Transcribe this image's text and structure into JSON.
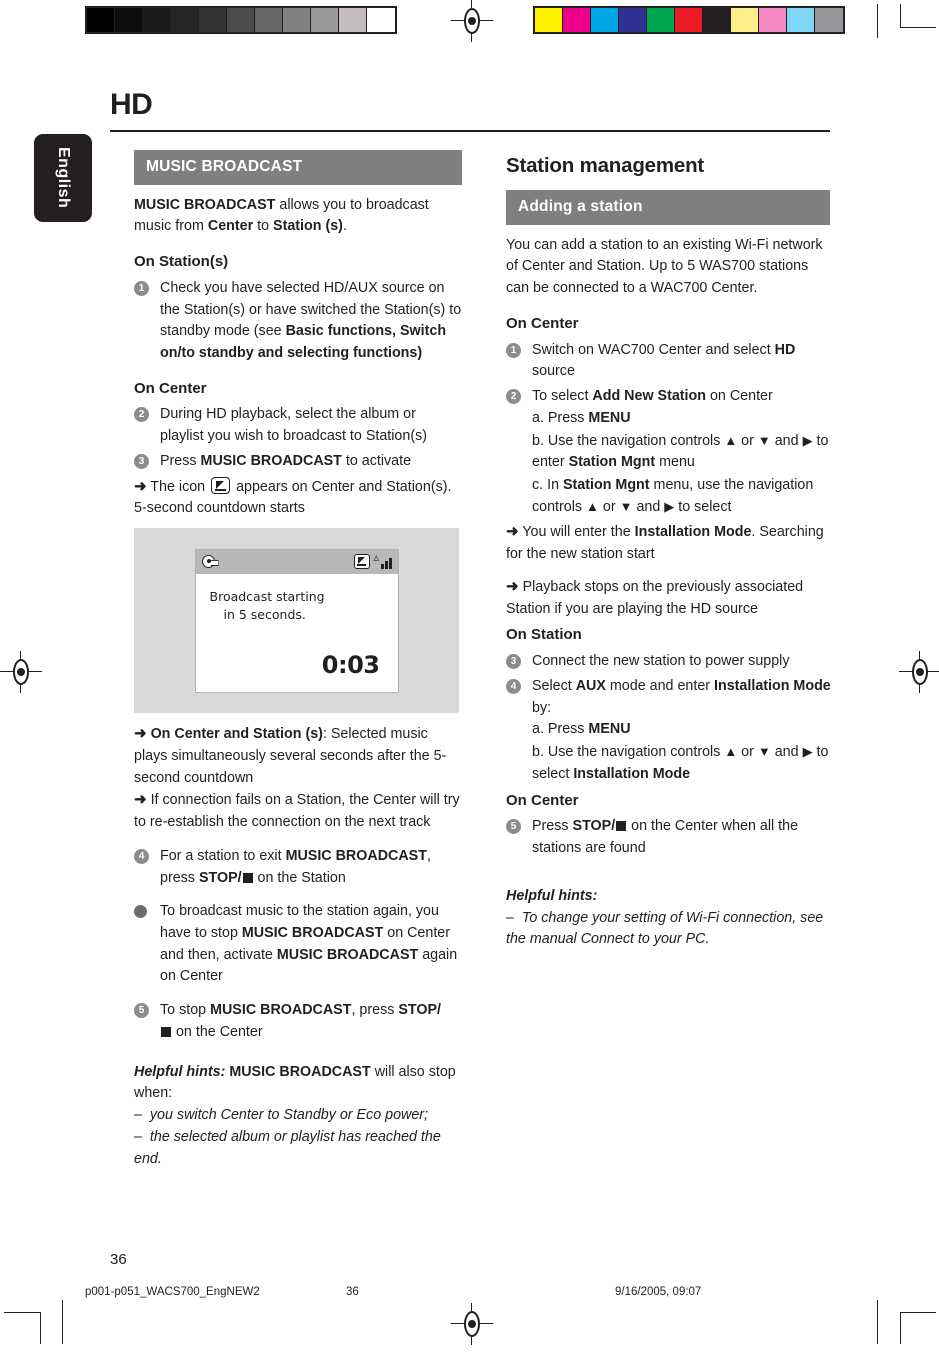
{
  "print_marks": {
    "gray_swatches": [
      "#000000",
      "#0d0d0d",
      "#1a1a1a",
      "#262626",
      "#333333",
      "#4d4d4d",
      "#666666",
      "#808080",
      "#999999",
      "#c4bcbc",
      "#ffffff"
    ],
    "color_swatches": [
      "#fff200",
      "#ec008c",
      "#00a7e7",
      "#2e3192",
      "#00a650",
      "#ed1c24",
      "#231f20",
      "#fdee87",
      "#f488c2",
      "#7fd6f7",
      "#939598"
    ]
  },
  "sidebar": {
    "language_tab": "English"
  },
  "header": {
    "chapter_title": "HD"
  },
  "left_column": {
    "section_bar": "MUSIC BROADCAST",
    "intro": {
      "lead": "MUSIC BROADCAST",
      "mid": " allows you to broadcast music from ",
      "center": "Center",
      "to": " to ",
      "station": "Station (s)",
      "period": "."
    },
    "subhead_station": "On Station(s)",
    "step1": {
      "num": "1",
      "text_a": "Check you have selected HD/AUX source on the Station(s) or have switched the Station(s) to standby mode (see ",
      "bold_b": "Basic functions, Switch on/to standby and selecting functions)"
    },
    "subhead_center": "On Center",
    "step2": {
      "num": "2",
      "text": "During HD playback,  select the album or playlist you wish to broadcast to Station(s)"
    },
    "step3": {
      "num": "3",
      "press": "Press ",
      "bold": "MUSIC BROADCAST",
      "tail": " to activate",
      "arrow_a": "The icon ",
      "arrow_b": " appears on Center and Station(s). 5-second countdown starts"
    },
    "lcd": {
      "message_line1": "Broadcast starting",
      "message_line2": "in 5 seconds.",
      "countdown": "0:03",
      "icons": {
        "left": "music-note-icon",
        "right_1": "broadcast-icon",
        "right_2": "signal-strength-icon"
      }
    },
    "result1": {
      "bold": "On Center and Station (s)",
      "text": ": Selected music plays simultaneously several seconds after the 5-second countdown"
    },
    "result2": {
      "text": "If connection fails on a Station, the Center will try to re-establish the connection on the next track"
    },
    "step4": {
      "num": "4",
      "pre": "For a station to exit ",
      "bold": "MUSIC BROADCAST",
      "mid": ", press ",
      "bold2": "STOP/",
      "post": " on the Station"
    },
    "bullet": {
      "pre": "To broadcast music to the station again, you have to stop ",
      "bold1": "MUSIC BROADCAST",
      "mid": " on Center and then, activate ",
      "bold2": "MUSIC BROADCAST",
      "post": " again on Center"
    },
    "step5": {
      "num": "5",
      "pre": "To stop ",
      "bold1": "MUSIC BROADCAST",
      "mid": ", press ",
      "bold2": "STOP/",
      "post": " on the Center"
    },
    "hints": {
      "label": "Helpful hints:",
      "bold": "MUSIC BROADCAST",
      "tail": " will also stop when:",
      "item1": "you switch Center to Standby or Eco power;",
      "item2": "the selected album or playlist has reached the end."
    }
  },
  "right_column": {
    "heading": "Station management",
    "section_bar": "Adding a station",
    "intro": "You can add a station to an existing Wi-Fi network of Center and Station. Up to 5 WAS700 stations can be connected to a WAC700 Center.",
    "subhead_center_1": "On Center",
    "step1": {
      "num": "1",
      "pre": "Switch on WAC700 Center and select ",
      "bold": "HD",
      "post": " source"
    },
    "step2": {
      "num": "2",
      "pre": "To select ",
      "bold": "Add New Station",
      "post": " on Center",
      "a": {
        "label": "a. Press ",
        "bold": "MENU"
      },
      "b": {
        "label": "b. Use the navigation controls ",
        "up": "▲",
        "or": " or ",
        "down": "▼",
        "and": " and ",
        "right": "▶",
        "tail": " to enter ",
        "bold": "Station Mgnt",
        "menu": " menu"
      },
      "c": {
        "label": "c.  In ",
        "bold": "Station Mgnt",
        "mid": " menu,  use the navigation controls ",
        "up": "▲",
        "or": " or ",
        "down": "▼",
        "and": " and ",
        "right": "▶",
        "tail": " to select"
      }
    },
    "result1": {
      "pre": "You will enter the ",
      "bold": "Installation Mode",
      "post": ". Searching for the new station start"
    },
    "result2": {
      "text": "Playback stops on the previously associated Station if you are playing the HD source"
    },
    "subhead_station": "On Station",
    "step3": {
      "num": "3",
      "text": "Connect the new station to power supply"
    },
    "step4": {
      "num": "4",
      "pre": "Select ",
      "bold1": "AUX",
      "mid": " mode and enter ",
      "bold2": "Installation Mode",
      "post": " by:",
      "a": {
        "label": "a. Press ",
        "bold": "MENU"
      },
      "b": {
        "label": "b. Use the navigation controls ",
        "up": "▲",
        "or": " or ",
        "down": "▼",
        "and": " and ",
        "right": "▶",
        "tail": " to select ",
        "bold": "Installation Mode"
      }
    },
    "subhead_center_2": "On Center",
    "step5": {
      "num": "5",
      "pre": "Press ",
      "bold": "STOP/",
      "post": " on the Center when all the stations are found"
    },
    "hints": {
      "label": "Helpful hints:",
      "item1": "To change your setting of Wi-Fi connection, see the manual Connect to your PC."
    }
  },
  "page_number": "36",
  "footer": {
    "file": "p001-p051_WACS700_EngNEW2",
    "page": "36",
    "date": "9/16/2005, 09:07"
  }
}
